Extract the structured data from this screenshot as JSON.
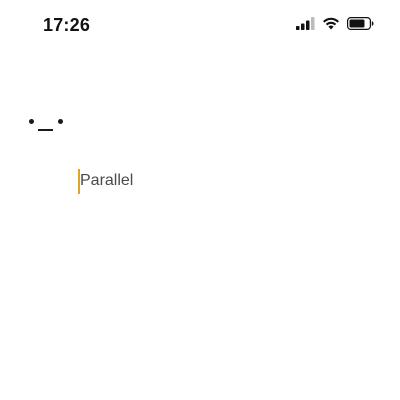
{
  "status_bar": {
    "time": "17:26",
    "icons": [
      "cellular-signal-icon",
      "wifi-icon",
      "battery-icon"
    ]
  },
  "content": {
    "emoticon_icon": "neutral-face-icon",
    "input_value": "Parallel"
  },
  "colors": {
    "caret": "#e0a526",
    "text": "#4a4a4a",
    "background": "#ffffff"
  }
}
